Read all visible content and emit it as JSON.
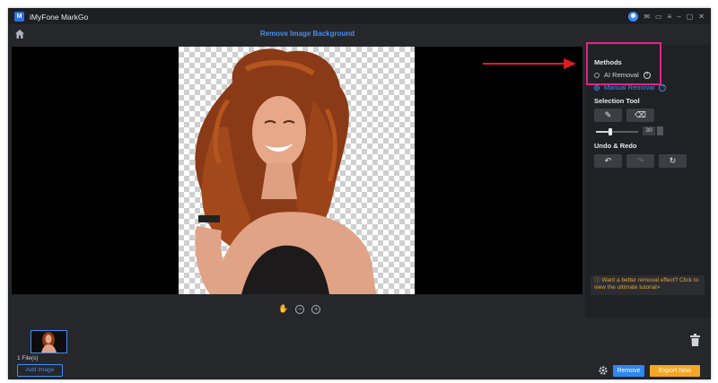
{
  "app": {
    "title": "iMyFone MarkGo",
    "logo_text": "M"
  },
  "window_controls": [
    "user-icon",
    "mail-icon",
    "chat-icon",
    "menu-icon",
    "minimize-icon",
    "restore-icon",
    "close-icon"
  ],
  "header": {
    "page_title": "Remove Image Background"
  },
  "panel": {
    "methods_title": "Methods",
    "methods": [
      {
        "label": "AI Removal",
        "selected": false
      },
      {
        "label": "Manual Removal",
        "selected": true
      }
    ],
    "selection_tool_title": "Selection Tool",
    "brush_size": "30",
    "brush_size_fraction": 0.35,
    "undo_redo_title": "Undo & Redo",
    "tip": "Want a better removal effect? Click to view the ultimate tutorial>"
  },
  "bottom": {
    "files_count": "1 File(s)",
    "add_image": "Add Image",
    "remove": "Remove",
    "export": "Export Now"
  },
  "colors": {
    "accent": "#3f8ef6",
    "highlight": "#e0228a",
    "export": "#f5a623",
    "arrow": "#e01b24"
  }
}
